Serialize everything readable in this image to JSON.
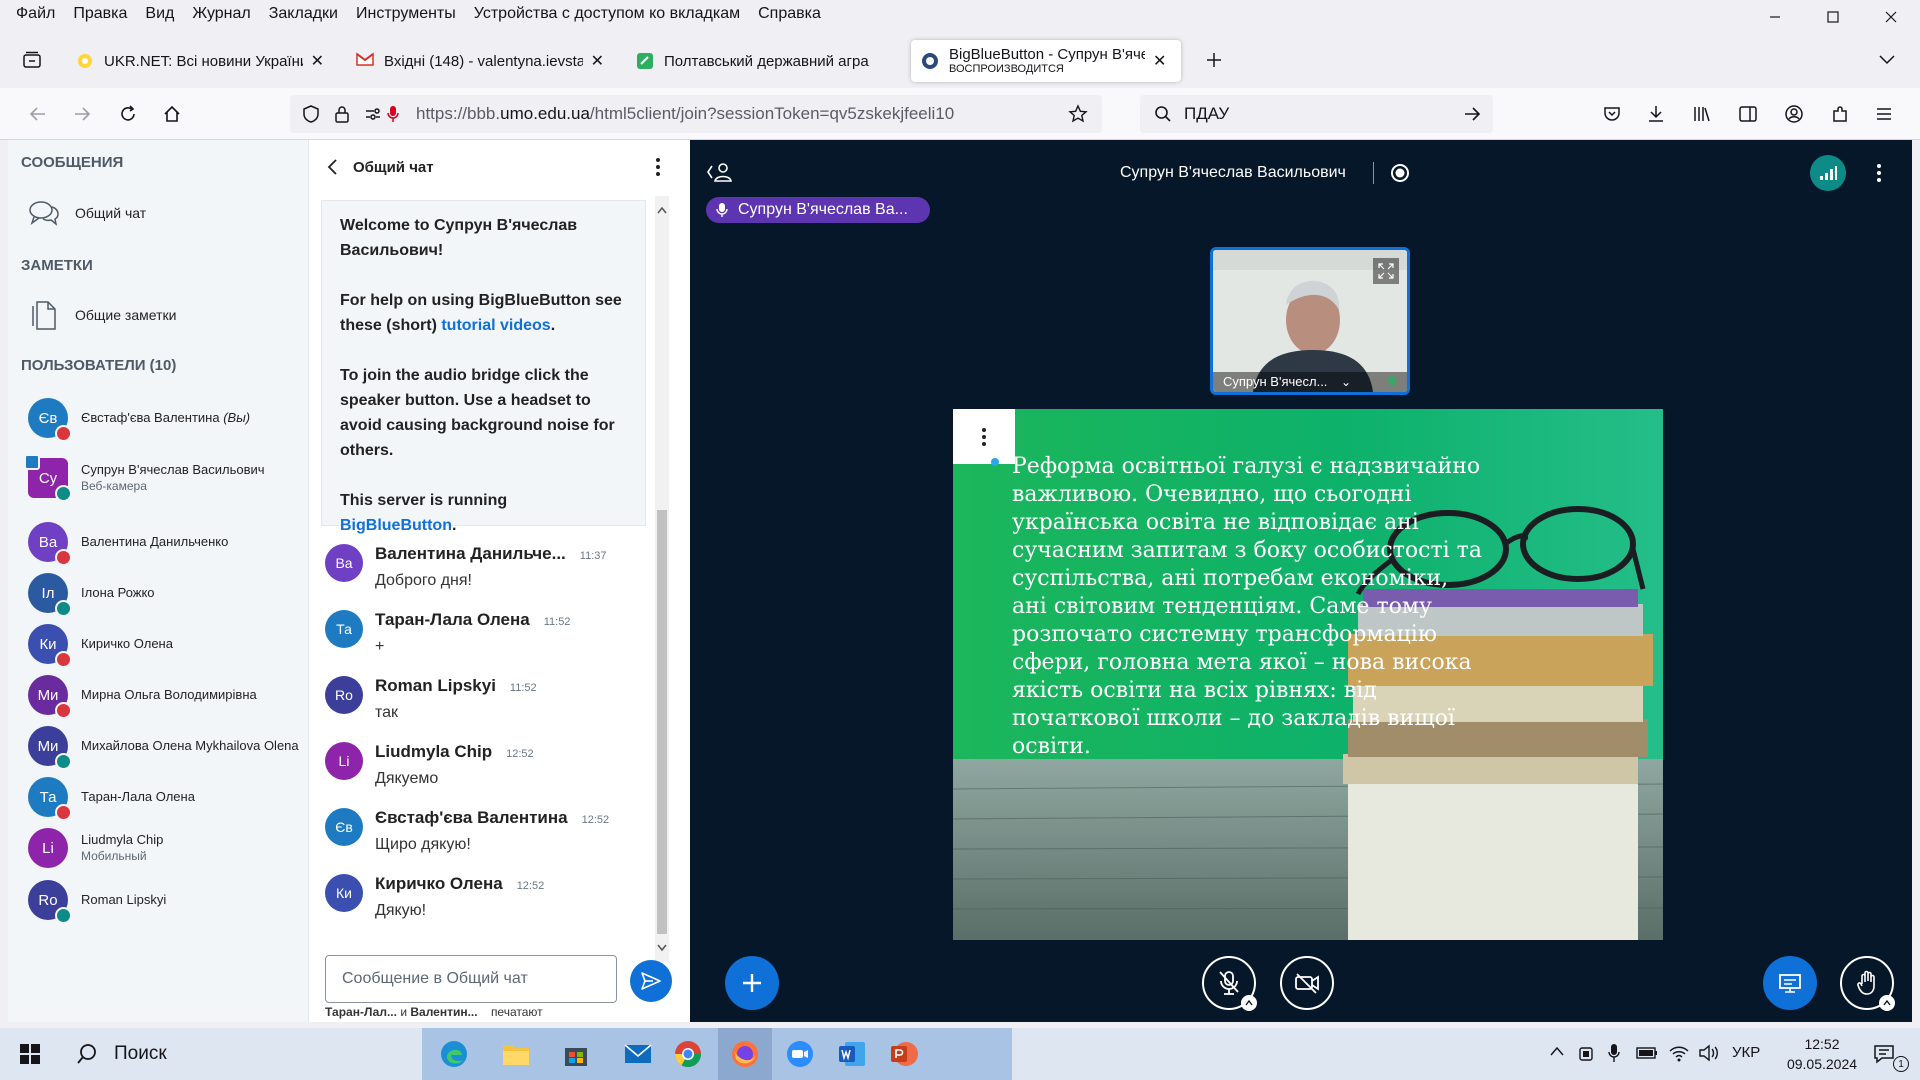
{
  "menu": [
    "Файл",
    "Правка",
    "Вид",
    "Журнал",
    "Закладки",
    "Инструменты",
    "Устройства с доступом ко вкладкам",
    "Справка"
  ],
  "tabs": [
    {
      "title": "UKR.NET: Всі новини України,",
      "sub": ""
    },
    {
      "title": "Вхідні (148) - valentyna.ievstafi",
      "sub": ""
    },
    {
      "title": "Полтавський державний агра",
      "sub": ""
    },
    {
      "title": "BigBlueButton - Супрун В'ячес",
      "sub": "ВОСПРОИЗВОДИТСЯ"
    }
  ],
  "url": {
    "prefix": "https://bbb.",
    "domain": "umo.edu.ua",
    "rest": "/html5client/join?sessionToken=qv5zskekjfeeli10"
  },
  "search_text": "ПДАУ",
  "sidebar": {
    "messages_title": "СООБЩЕНИЯ",
    "public_chat": "Общий чат",
    "notes_title": "ЗАМЕТКИ",
    "shared_notes": "Общие заметки",
    "users_title": "ПОЛЬЗОВАТЕЛИ (10)",
    "users": [
      {
        "initials": "Єв",
        "name": "Євстаф'єва Валентина",
        "you": "(Вы)",
        "sub": "",
        "color": "#1f7bc1",
        "badge": "#d9363e"
      },
      {
        "initials": "Су",
        "name": "Супрун В'ячеслав Васильович",
        "you": "",
        "sub": "Веб-камера",
        "color": "#8e24aa",
        "badge": "#0d8c87"
      },
      {
        "initials": "Ва",
        "name": "Валентина Данильченко",
        "you": "",
        "sub": "",
        "color": "#6f3fc4",
        "badge": "#d9363e"
      },
      {
        "initials": "Іл",
        "name": "Ілона Рожко",
        "you": "",
        "sub": "",
        "color": "#2c5aa0",
        "badge": "#0d8c87"
      },
      {
        "initials": "Ки",
        "name": "Киричко Олена",
        "you": "",
        "sub": "",
        "color": "#3a4fb0",
        "badge": "#d9363e"
      },
      {
        "initials": "Ми",
        "name": "Мирна Ольга Володимирівна",
        "you": "",
        "sub": "",
        "color": "#6a2b9e",
        "badge": "#d9363e"
      },
      {
        "initials": "Ми",
        "name": "Михайлова Олена Mykhailova Olena",
        "you": "",
        "sub": "",
        "color": "#3b3f99",
        "badge": "#0d8c87"
      },
      {
        "initials": "Та",
        "name": "Таран-Лала Олена",
        "you": "",
        "sub": "",
        "color": "#1f7bc1",
        "badge": "#d9363e"
      },
      {
        "initials": "Li",
        "name": "Liudmyla Chip",
        "you": "",
        "sub": "Мобильный",
        "color": "#8e24aa",
        "badge": ""
      },
      {
        "initials": "Ro",
        "name": "Roman Lipskyi",
        "you": "",
        "sub": "",
        "color": "#3b3f99",
        "badge": "#0d8c87"
      }
    ]
  },
  "chat": {
    "title": "Общий чат",
    "welcome_prefix": "Welcome to ",
    "welcome_name": "Супрун В'ячеслав Васильович",
    "welcome_suffix": "!",
    "help_text": "For help on using BigBlueButton see these (short) ",
    "help_link": "tutorial videos",
    "help_end": ".",
    "audio_text": "To join the audio bridge click the speaker button. Use a headset to avoid causing background noise for others.",
    "server_text": "This server is running ",
    "server_link": "BigBlueButton",
    "server_end": ".",
    "messages": [
      {
        "initials": "Ва",
        "name": "Валентина Данильче...",
        "time": "11:37",
        "text": "Доброго дня!",
        "color": "#6f3fc4"
      },
      {
        "initials": "Та",
        "name": "Таран-Лала Олена",
        "time": "11:52",
        "text": "+",
        "color": "#1f7bc1"
      },
      {
        "initials": "Ro",
        "name": "Roman Lipskyi",
        "time": "11:52",
        "text": "так",
        "color": "#3b3f99"
      },
      {
        "initials": "Li",
        "name": "Liudmyla Chip",
        "time": "12:52",
        "text": "Дякуемо",
        "color": "#8e24aa"
      },
      {
        "initials": "Єв",
        "name": "Євстаф'єва Валентина",
        "time": "12:52",
        "text": "Щиро дякую!",
        "color": "#1f7bc1"
      },
      {
        "initials": "Ки",
        "name": "Киричко Олена",
        "time": "12:52",
        "text": "Дякую!",
        "color": "#3a4fb0"
      }
    ],
    "input_placeholder": "Сообщение в Общий чат",
    "typing_names": "Таран-Лал...",
    "typing_and": " и ",
    "typing_names2": "Валентин...",
    "typing_suffix": "печатают"
  },
  "main": {
    "presenter_title": "Супрун В'ячеслав Васильович",
    "talking_name": "Супрун В'ячеслав Ва...",
    "webcam_name": "Супрун В'ячесл...",
    "slide_text": "Реформа освітньої галузі є надзвичайно важливою. Очевидно, що сьогодні українська освіта не відповідає ані сучасним запитам з боку особистості та суспільства, ані потребам економіки, ані світовим тенденціям. Саме тому розпочато системну трансформацію сфери, головна мета якої – нова висока якість освіти на всіх рівнях: від початкової школи – до закладів вищої освіти."
  },
  "taskbar": {
    "search_label": "Поиск",
    "lang": "УКР",
    "time": "12:52",
    "date": "09.05.2024",
    "notif_count": "1"
  }
}
